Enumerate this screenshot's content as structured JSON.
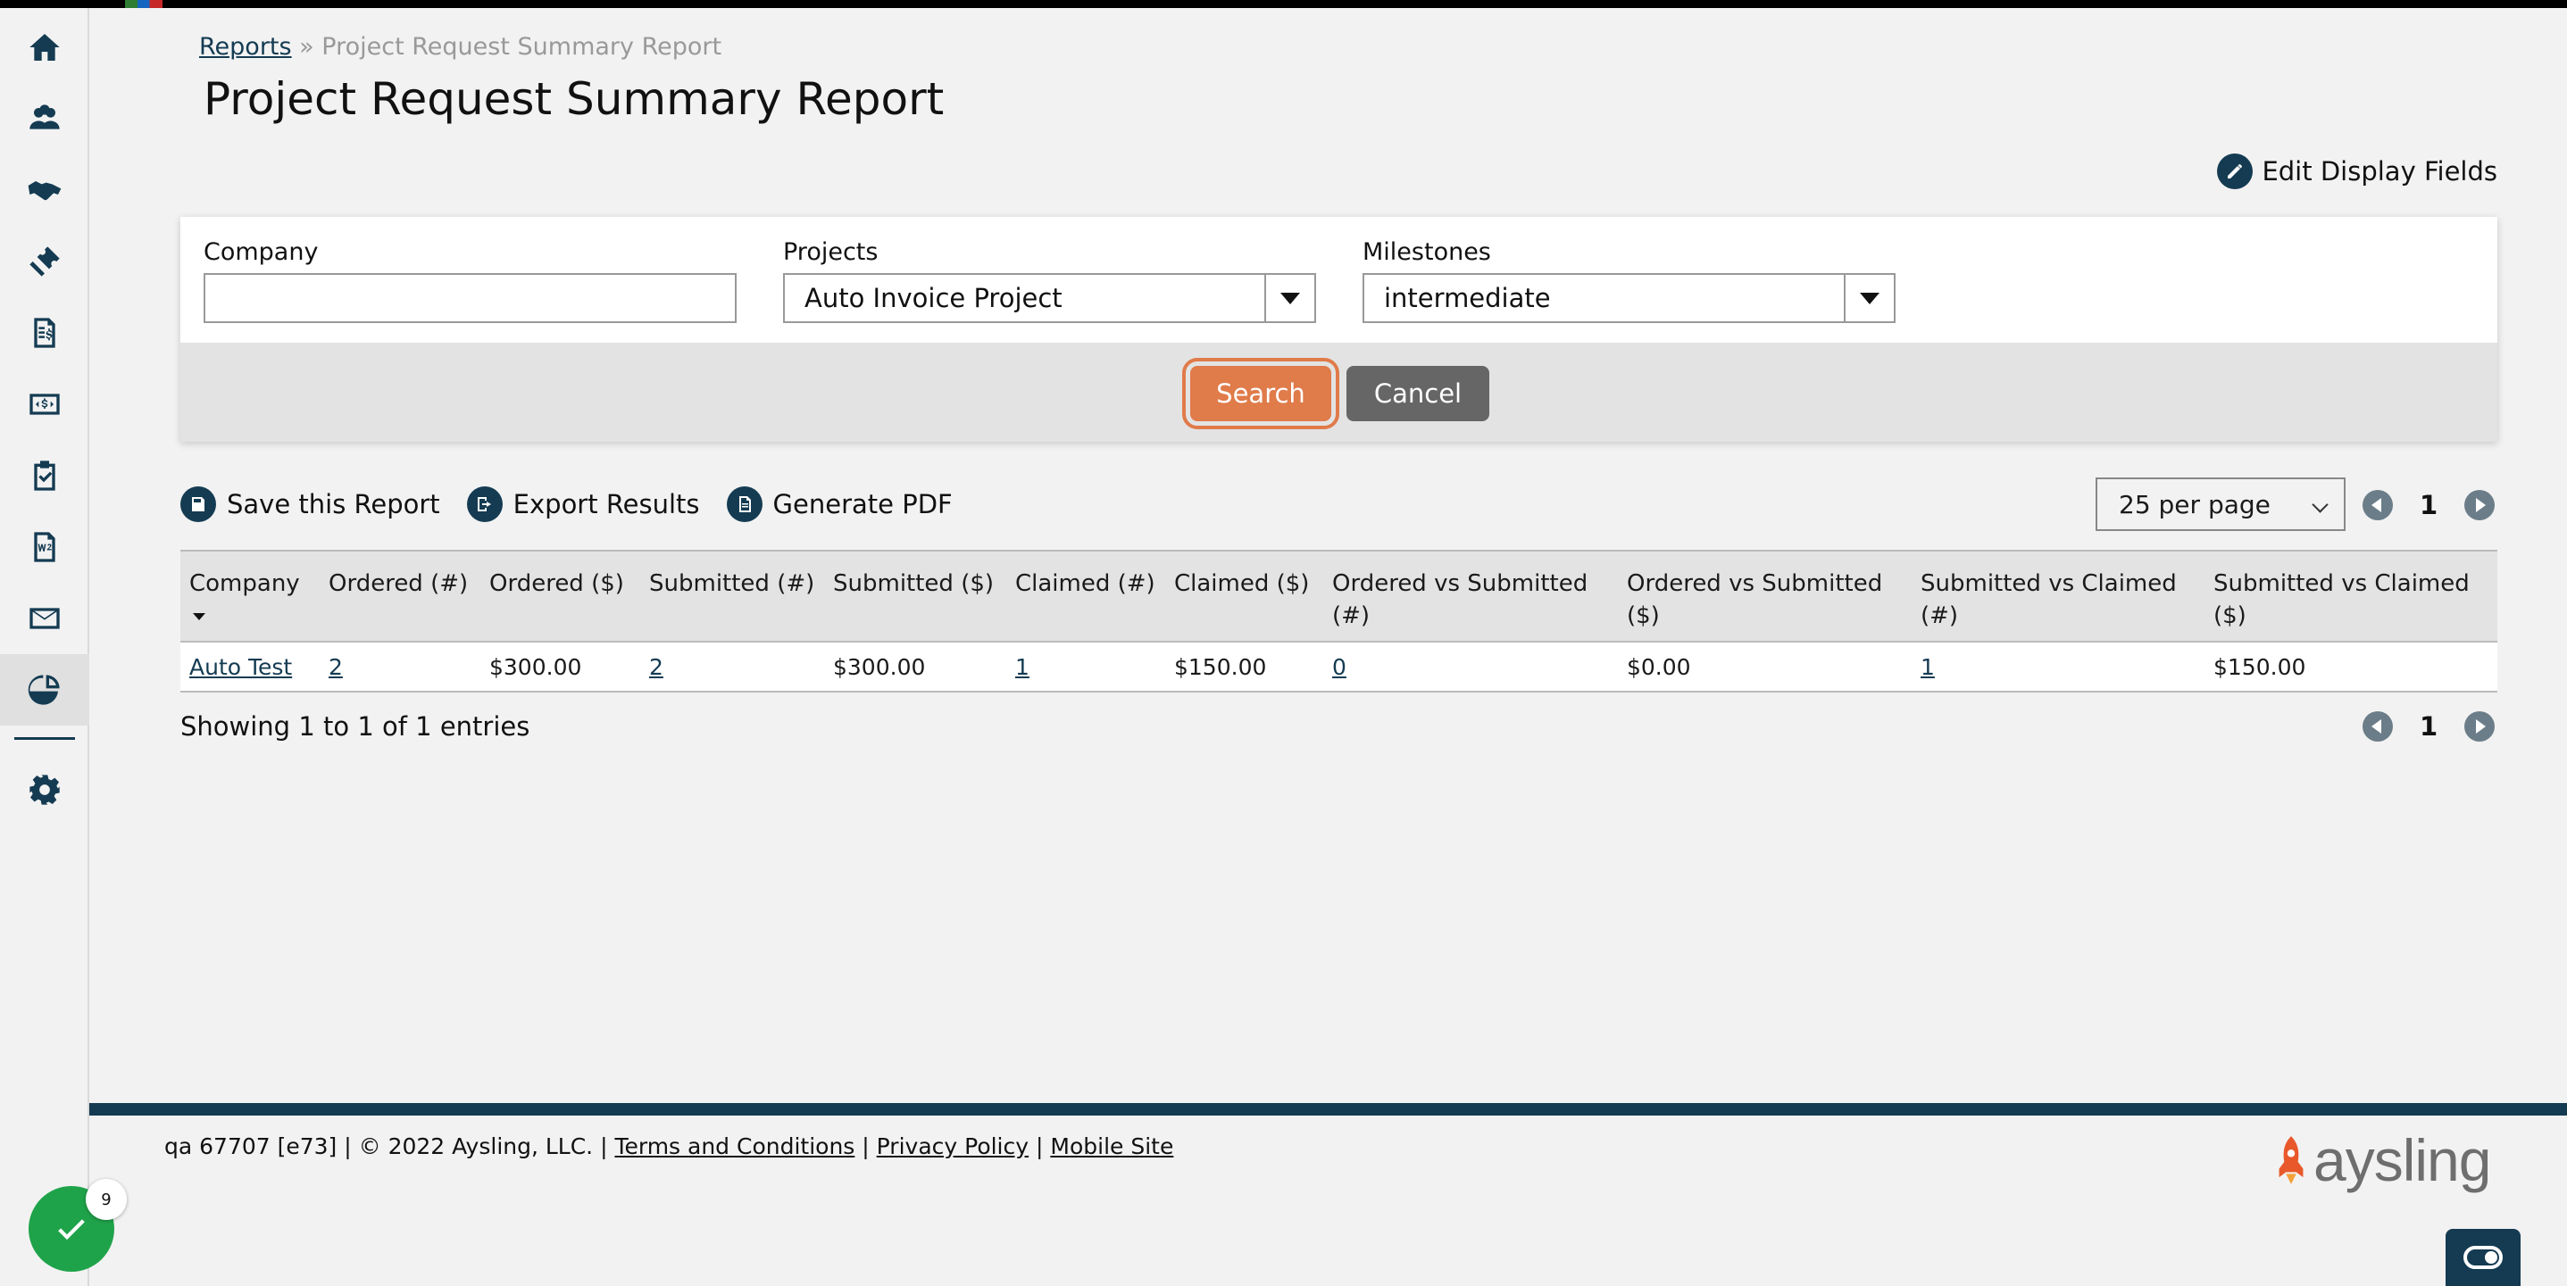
{
  "breadcrumb": {
    "root": "Reports",
    "separator": "»",
    "current": "Project Request Summary Report"
  },
  "page_title": "Project Request Summary Report",
  "edit_display_fields": "Edit Display Fields",
  "filters": {
    "company": {
      "label": "Company",
      "value": ""
    },
    "projects": {
      "label": "Projects",
      "value": "Auto Invoice Project"
    },
    "milestones": {
      "label": "Milestones",
      "value": "intermediate"
    },
    "search_label": "Search",
    "cancel_label": "Cancel"
  },
  "toolbar": {
    "save": "Save this Report",
    "export": "Export Results",
    "pdf": "Generate PDF"
  },
  "per_page": "25 per page",
  "page_number": "1",
  "table": {
    "headers": [
      "Company",
      "Ordered (#)",
      "Ordered ($)",
      "Submitted (#)",
      "Submitted ($)",
      "Claimed (#)",
      "Claimed ($)",
      "Ordered vs Submitted (#)",
      "Ordered vs Submitted ($)",
      "Submitted vs Claimed (#)",
      "Submitted vs Claimed ($)"
    ],
    "rows": [
      [
        "Auto Test",
        "2",
        "$300.00",
        "2",
        "$300.00",
        "1",
        "$150.00",
        "0",
        "$0.00",
        "1",
        "$150.00"
      ]
    ]
  },
  "showing": "Showing 1 to 1 of 1 entries",
  "footer": {
    "info": "qa 67707 [e73] | © 2022 Aysling, LLC. |",
    "terms": "Terms and Conditions",
    "privacy": "Privacy Policy",
    "mobile": "Mobile Site",
    "sep": "|"
  },
  "brand": "aysling",
  "notification_count": "9",
  "colors": {
    "primary": "#143b52",
    "accent": "#e07b4a",
    "success": "#1fa34a",
    "cancel": "#666666"
  },
  "sidebar_icons": [
    "home-icon",
    "users-icon",
    "handshake-icon",
    "ticket-icon",
    "invoice-icon",
    "money-icon",
    "clipboard-icon",
    "w2-icon",
    "mail-icon",
    "reports-icon",
    "gear-icon"
  ]
}
